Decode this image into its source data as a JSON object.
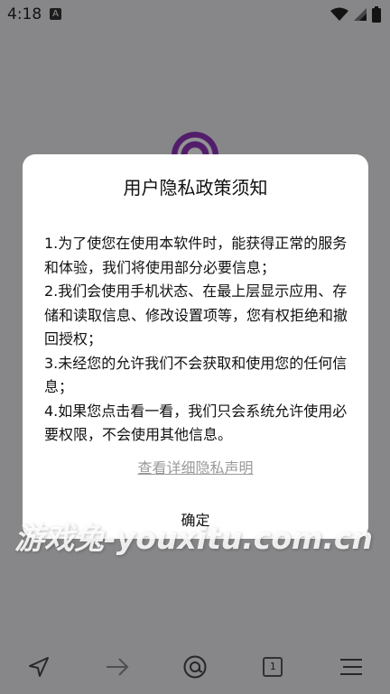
{
  "status_bar": {
    "time": "4:18",
    "app_icon_letter": "A",
    "icons": [
      "wifi-icon",
      "signal-icon",
      "battery-icon"
    ]
  },
  "dialog": {
    "title": "用户隐私政策须知",
    "items": [
      "1.为了使您在使用本软件时，能获得正常的服务和体验，我们将使用部分必要信息；",
      " 2.我们会使用手机状态、在最上层显示应用、存储和读取信息、修改设置项等，您有权拒绝和撤回授权；",
      " 3.未经您的允许我们不会获取和使用您的任何信息；",
      " 4.如果您点击看一看，我们只会系统允许使用必要权限，不会使用其他信息。"
    ],
    "privacy_link": "查看详细隐私声明",
    "confirm": "确定"
  },
  "toolbar": {
    "tab_count": "1",
    "icons": [
      "send-icon",
      "forward-icon",
      "at-icon",
      "tabs-icon",
      "menu-icon"
    ]
  },
  "watermark": "游戏兔-youxitu.com.cn",
  "colors": {
    "logo_purple": "#8e35b8",
    "link_gray": "#9a9a9a"
  }
}
